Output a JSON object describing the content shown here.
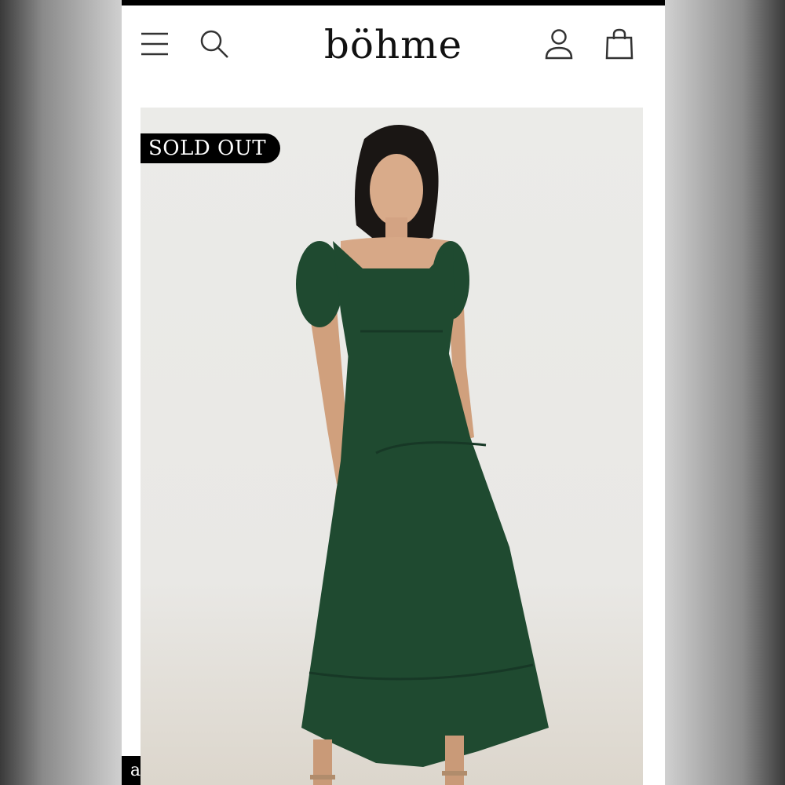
{
  "header": {
    "brand": "böhme",
    "menu_icon": "hamburger-menu-icon",
    "search_icon": "search-icon",
    "account_icon": "user-account-icon",
    "bag_icon": "shopping-bag-icon"
  },
  "product": {
    "badge": "SOLD OUT",
    "image_subject": "green-lace-midi-dress-photo",
    "dress_color": "#1f4a30"
  },
  "colors": {
    "background_side": "#8a8a8a",
    "header_bg": "#ffffff",
    "badge_bg": "#000000",
    "badge_text": "#ffffff"
  },
  "corner": {
    "glyph": "a"
  }
}
